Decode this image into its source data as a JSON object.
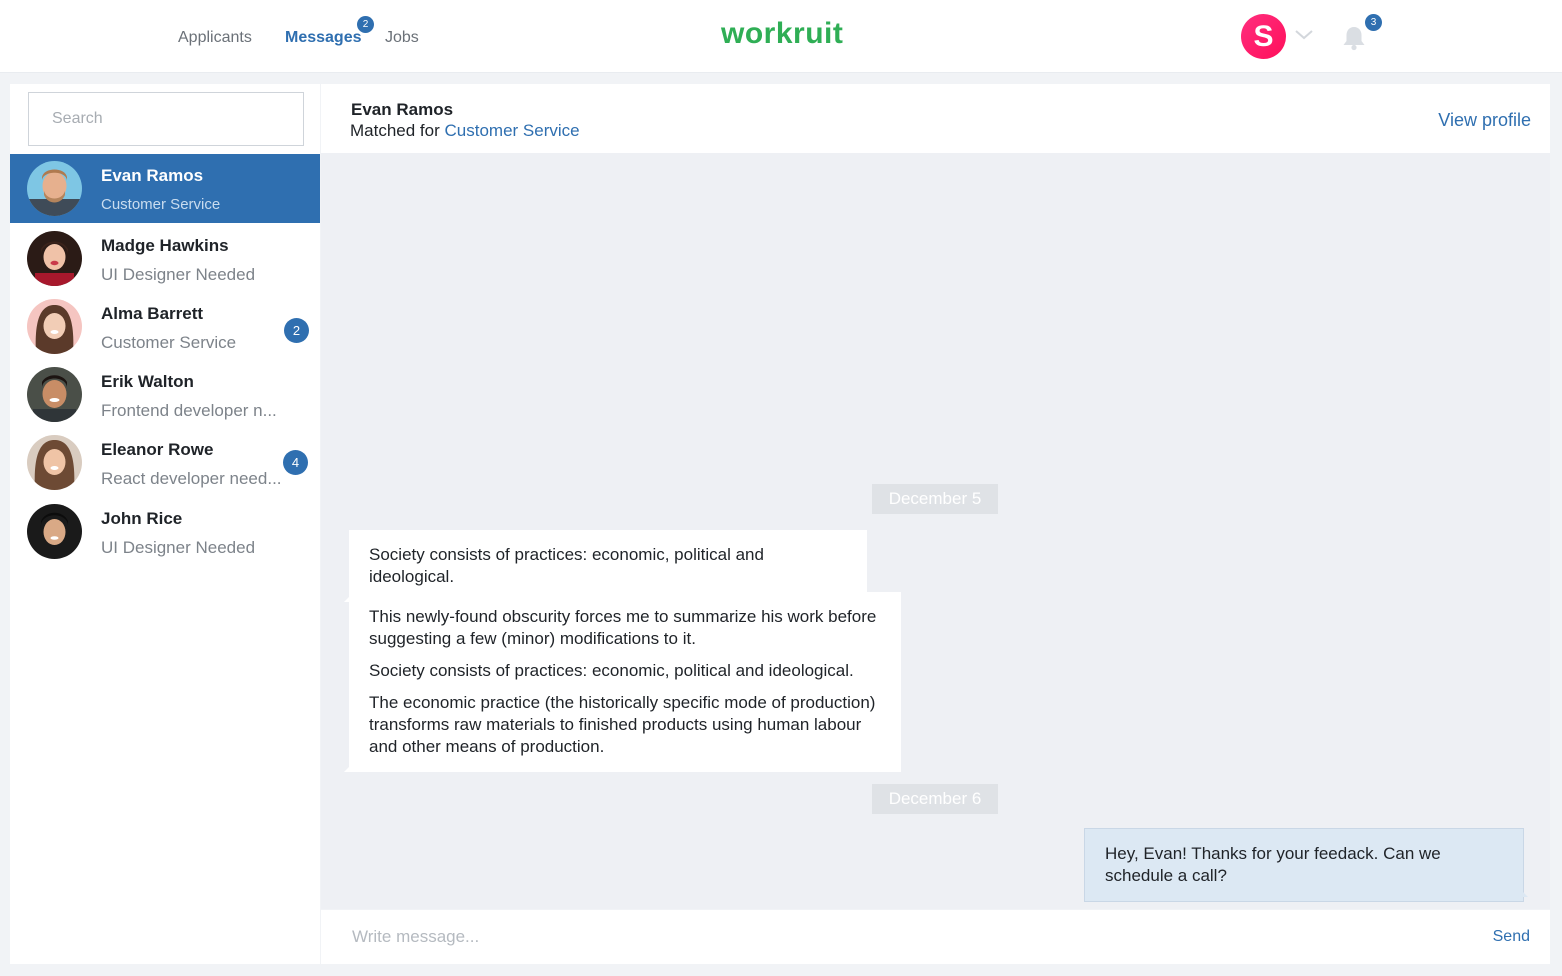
{
  "nav": {
    "applicants": "Applicants",
    "messages": "Messages",
    "messages_badge": "2",
    "jobs": "Jobs",
    "logo": "workruit",
    "user_initial": "S",
    "notifications_badge": "3",
    "accent": "#2f6fb0",
    "brand": "#2fae55"
  },
  "sidebar": {
    "search_placeholder": "Search",
    "contacts": [
      {
        "name": "Evan Ramos",
        "role": "Customer Service",
        "unread": "",
        "active": true
      },
      {
        "name": "Madge Hawkins",
        "role": "UI Designer Needed",
        "unread": ""
      },
      {
        "name": "Alma Barrett",
        "role": "Customer Service",
        "unread": "2"
      },
      {
        "name": "Erik Walton",
        "role": "Frontend developer n...",
        "unread": ""
      },
      {
        "name": "Eleanor Rowe",
        "role": "React developer need...",
        "unread": "4"
      },
      {
        "name": "John Rice",
        "role": "UI Designer Needed",
        "unread": ""
      }
    ]
  },
  "chat": {
    "name": "Evan Ramos",
    "matched_prefix": "Matched for",
    "matched_job": "Customer Service",
    "view_profile": "View profile",
    "date_1": "December 5",
    "msg_1": "Society consists of practices: economic, political and ideological.",
    "msg_2_p1": "This newly-found obscurity forces me to summarize his work before suggesting a few (minor) modifications to it.",
    "msg_2_p2": "Society consists of practices: economic, political and ideological.",
    "msg_2_p3": "The economic practice (the historically specific mode of production) transforms raw materials to finished products using human labour and other means of production.",
    "date_2": "December 6",
    "msg_3": "Hey, Evan! Thanks for your feedack. Can we schedule a call?",
    "composer_placeholder": "Write message...",
    "send": "Send"
  }
}
